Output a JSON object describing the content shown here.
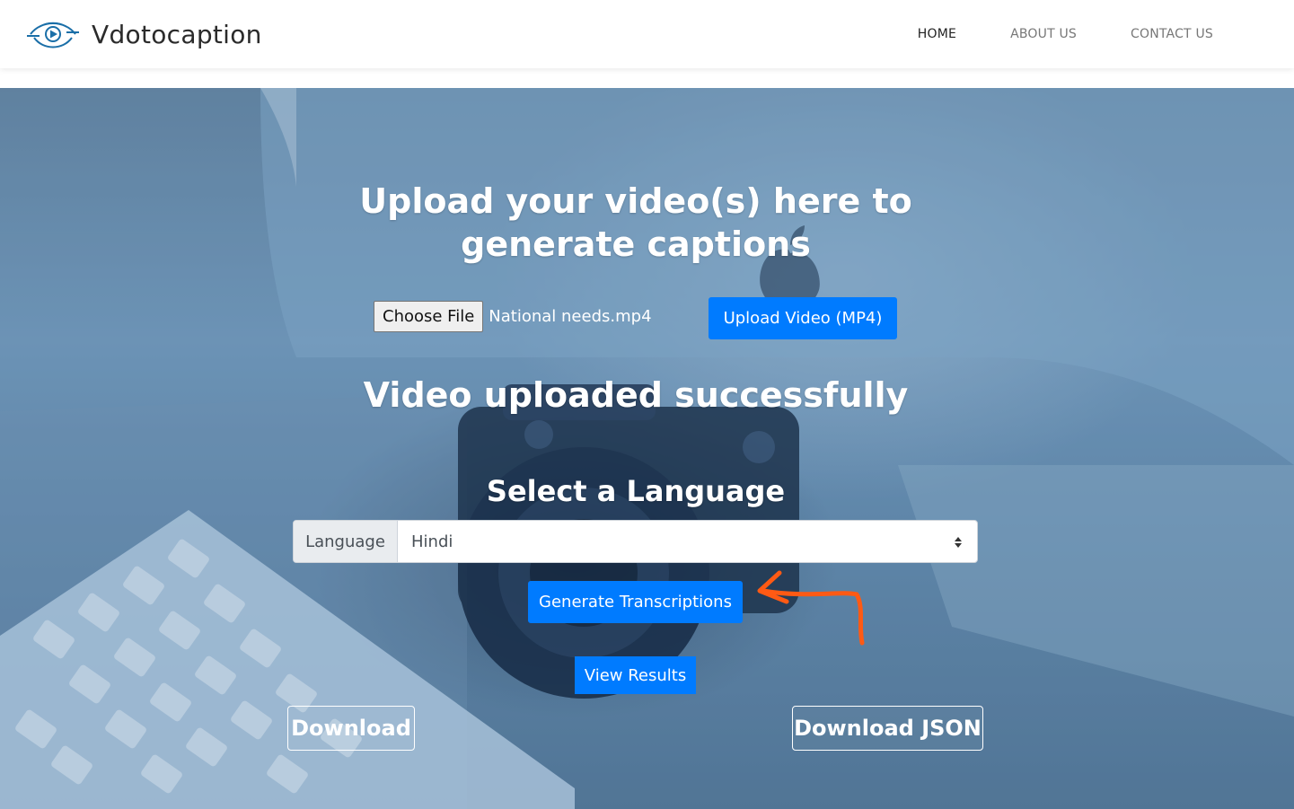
{
  "navbar": {
    "brand": "Vdotocaption",
    "links": [
      {
        "label": "HOME",
        "active": true
      },
      {
        "label": "ABOUT US",
        "active": false
      },
      {
        "label": "CONTACT US",
        "active": false
      }
    ]
  },
  "hero": {
    "headline": "Upload your video(s) here to generate captions",
    "file_input": {
      "button_label": "Choose File",
      "file_name": "National needs.mp4"
    },
    "upload_button": "Upload Video (MP4)",
    "status_message": "Video uploaded successfully",
    "language_heading": "Select a Language",
    "language_select": {
      "addon_label": "Language",
      "selected": "Hindi"
    },
    "generate_button": "Generate Transcriptions",
    "view_results_button": "View Results",
    "download_button": "Download",
    "download_json_button": "Download JSON"
  },
  "colors": {
    "primary": "#007bff",
    "annotation_arrow": "#ff5a14",
    "logo_blue": "#1b6fa8"
  },
  "icons": {
    "logo": "eye-play-icon",
    "select_caret": "up-down-caret-icon",
    "annotation": "hand-drawn-arrow-icon"
  }
}
